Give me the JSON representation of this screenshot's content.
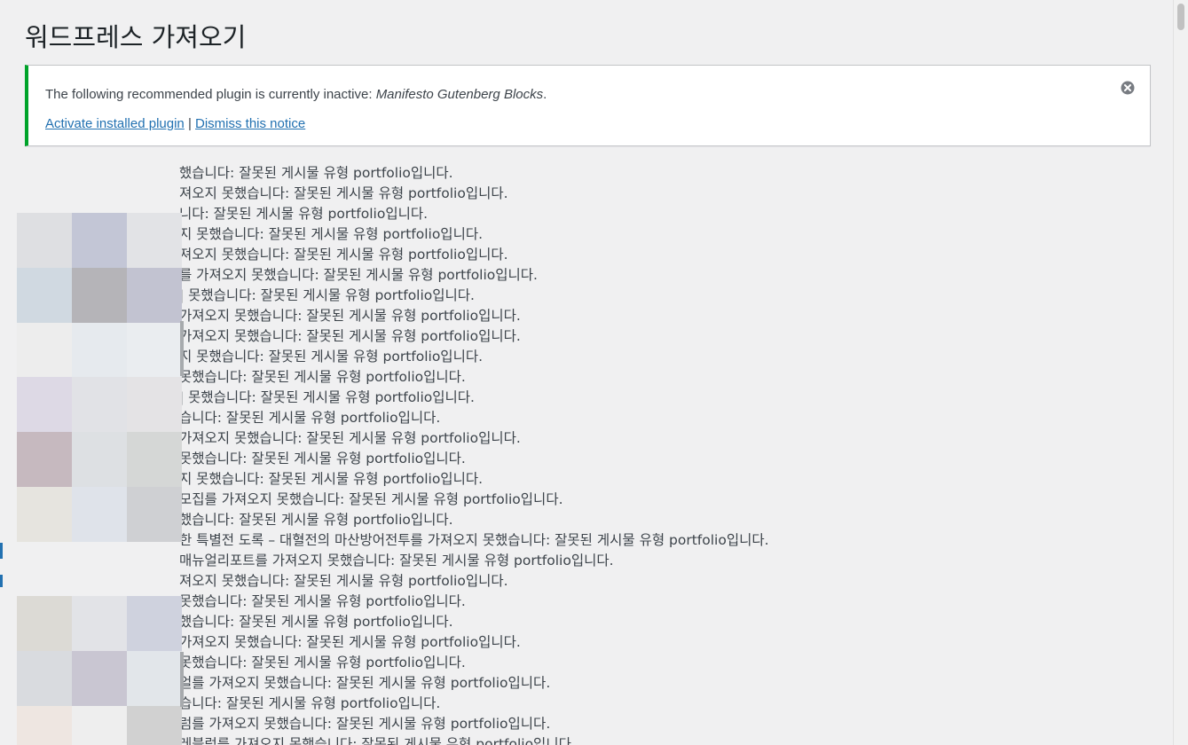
{
  "page_title": "워드프레스 가져오기",
  "notice": {
    "message_prefix": "The following recommended plugin is currently inactive: ",
    "plugin_name": "Manifesto Gutenberg Blocks",
    "message_suffix": ".",
    "activate_link": "Activate installed plugin",
    "separator": "|",
    "dismiss_link": "Dismiss this notice",
    "accent_color": "#00a32a",
    "link_color": "#2271b1",
    "dismiss_icon": "close-circle-icon"
  },
  "log_lines": [
    "했습니다: 잘못된 게시물 유형 portfolio입니다.",
    "져오지 못했습니다: 잘못된 게시물 유형 portfolio입니다.",
    "니다: 잘못된 게시물 유형 portfolio입니다.",
    "지 못했습니다: 잘못된 게시물 유형 portfolio입니다.",
    "져오지 못했습니다: 잘못된 게시물 유형 portfolio입니다.",
    "를 가져오지 못했습니다: 잘못된 게시물 유형 portfolio입니다.",
    "| 못했습니다: 잘못된 게시물 유형 portfolio입니다.",
    "가져오지 못했습니다: 잘못된 게시물 유형 portfolio입니다.",
    "가져오지 못했습니다: 잘못된 게시물 유형 portfolio입니다.",
    "지 못했습니다: 잘못된 게시물 유형 portfolio입니다.",
    "못했습니다: 잘못된 게시물 유형 portfolio입니다.",
    "| 못했습니다: 잘못된 게시물 유형 portfolio입니다.",
    "습니다: 잘못된 게시물 유형 portfolio입니다.",
    "가져오지 못했습니다: 잘못된 게시물 유형 portfolio입니다.",
    "못했습니다: 잘못된 게시물 유형 portfolio입니다.",
    "지 못했습니다: 잘못된 게시물 유형 portfolio입니다.",
    "모집를 가져오지 못했습니다: 잘못된 게시물 유형 portfolio입니다.",
    "했습니다: 잘못된 게시물 유형 portfolio입니다.",
    "한 특별전 도록 – 대혈전의 마산방어전투를 가져오지 못했습니다: 잘못된 게시물 유형 portfolio입니다.",
    "매뉴얼리포트를 가져오지 못했습니다: 잘못된 게시물 유형 portfolio입니다.",
    "져오지 못했습니다: 잘못된 게시물 유형 portfolio입니다.",
    "못했습니다: 잘못된 게시물 유형 portfolio입니다.",
    "했습니다: 잘못된 게시물 유형 portfolio입니다.",
    "가져오지 못했습니다: 잘못된 게시물 유형 portfolio입니다.",
    "못했습니다: 잘못된 게시물 유형 portfolio입니다.",
    "얼를 가져오지 못했습니다: 잘못된 게시물 유형 portfolio입니다.",
    "습니다: 잘못된 게시물 유형 portfolio입니다.",
    "럼를 가져오지 못했습니다: 잘못된 게시물 유형 portfolio입니다.",
    "레블럼를 가져오지 못했습니다: 잘못된 게시물 유형 portfolio입니다."
  ],
  "mosaic_colors": {
    "block_a": [
      "#dedfe2",
      "#c3c6d6",
      "#e2e3e6",
      "#d0d9e1",
      "#b5b4b8",
      "#c2c3d1",
      "#ededed",
      "#e6eaee",
      "#eaedf0"
    ],
    "block_b": [
      "#ddd9e5",
      "#e1e2e6",
      "#e4e3e5",
      "#c6b9bf",
      "#dde0e3",
      "#d5d7d6",
      "#e6e4df",
      "#dfe3ea",
      "#cfd0d3"
    ],
    "block_c": [
      "#dcdad5",
      "#e2e3e7",
      "#cfd2de",
      "#d9dbdf",
      "#c9c6d2",
      "#e2e6ea",
      "#eee6e1",
      "#eeeeee",
      "#d1d1d1"
    ]
  }
}
